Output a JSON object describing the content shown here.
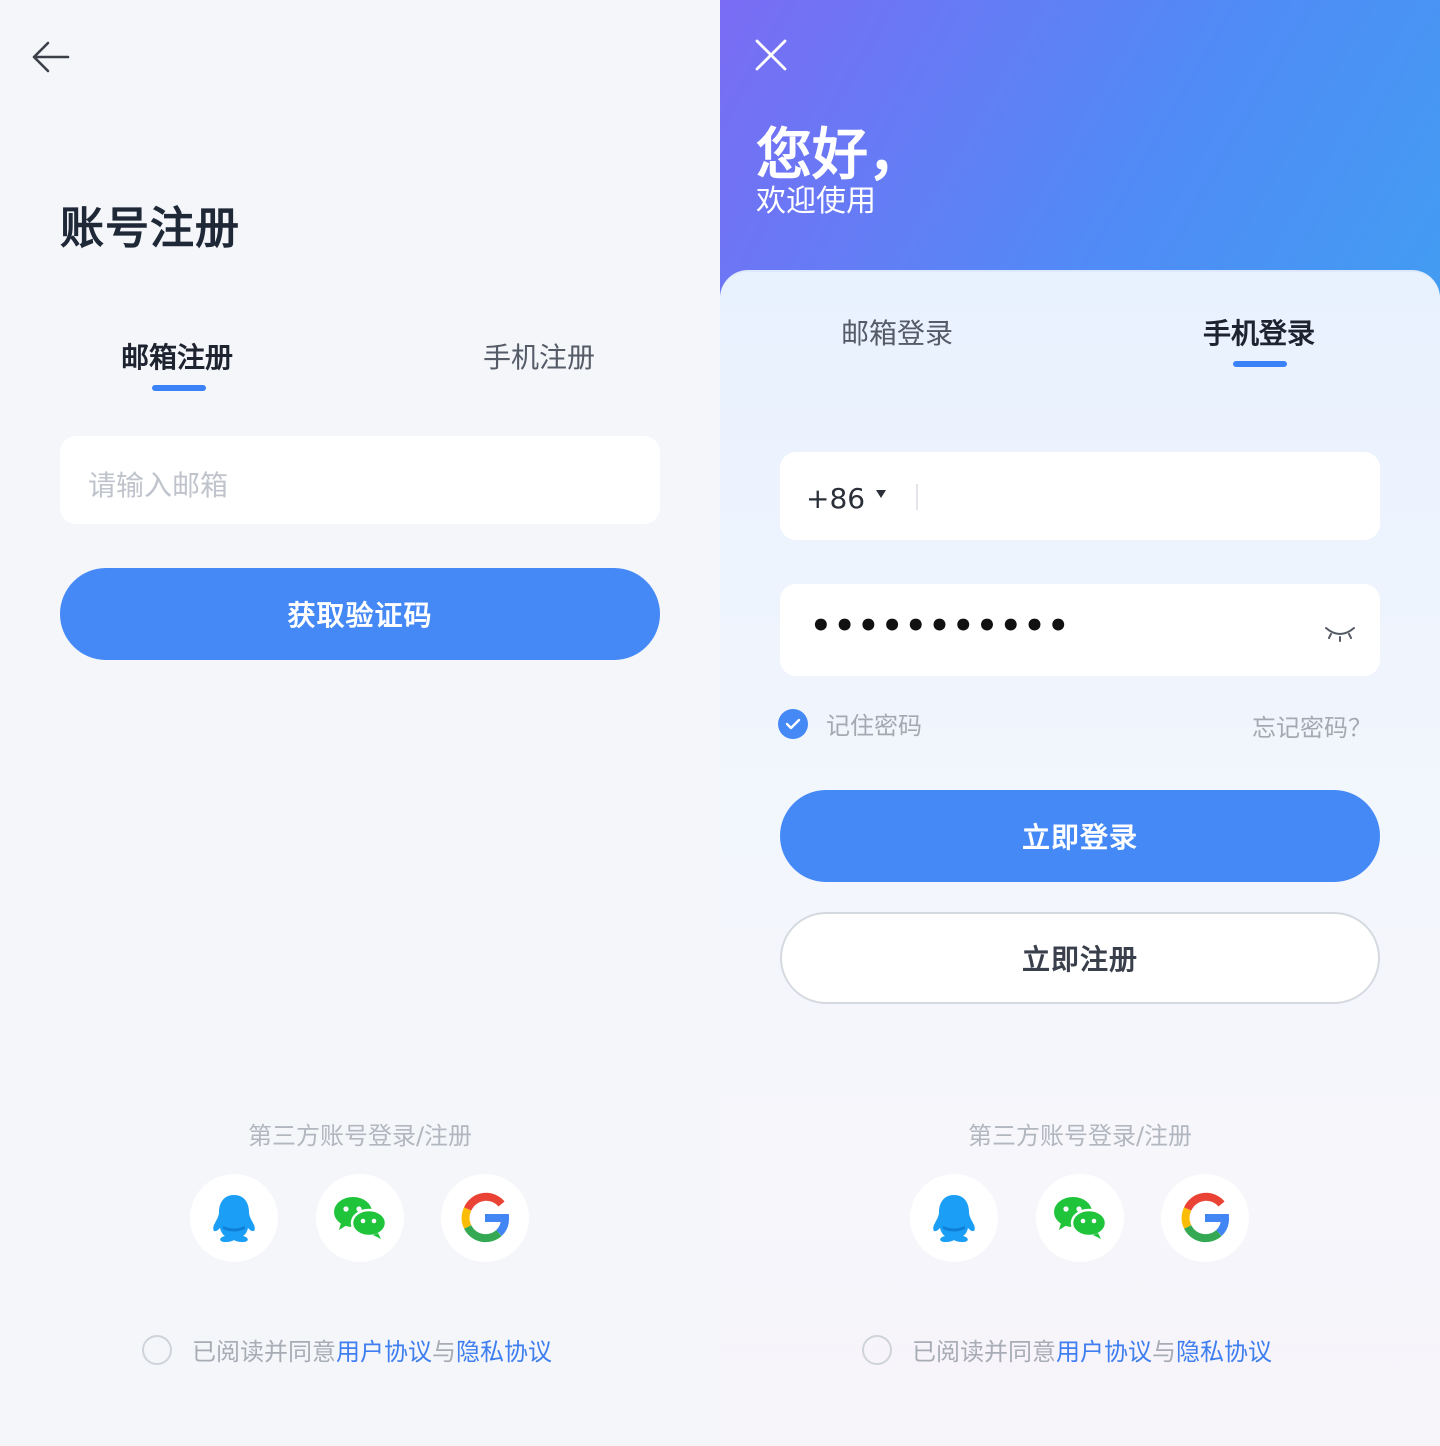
{
  "register": {
    "title": "账号注册",
    "tabs": [
      {
        "label": "邮箱注册",
        "active": true
      },
      {
        "label": "手机注册",
        "active": false
      }
    ],
    "email_placeholder": "请输入邮箱",
    "get_code_button": "获取验证码",
    "third_party_label": "第三方账号登录/注册",
    "social": [
      "qq-icon",
      "wechat-icon",
      "google-icon"
    ],
    "agreement": {
      "prefix": "已阅读并同意",
      "user_agreement": "用户协议",
      "joiner": "与",
      "privacy_agreement": "隐私协议"
    }
  },
  "login": {
    "greeting": "您好，",
    "welcome": "欢迎使用",
    "tabs": [
      {
        "label": "邮箱登录",
        "active": false
      },
      {
        "label": "手机登录",
        "active": true
      }
    ],
    "country_code": "+86",
    "password_masked": "•••••••••••",
    "remember_password": "记住密码",
    "remember_checked": true,
    "forgot_password": "忘记密码？",
    "login_button": "立即登录",
    "register_button": "立即注册",
    "third_party_label": "第三方账号登录/注册",
    "social": [
      "qq-icon",
      "wechat-icon",
      "google-icon"
    ],
    "agreement": {
      "prefix": "已阅读并同意",
      "user_agreement": "用户协议",
      "joiner": "与",
      "privacy_agreement": "隐私协议"
    }
  },
  "colors": {
    "accent": "#4589f7",
    "link": "#3f7ef0",
    "qq": "#1a9ef6",
    "wechat": "#1fc43a"
  }
}
